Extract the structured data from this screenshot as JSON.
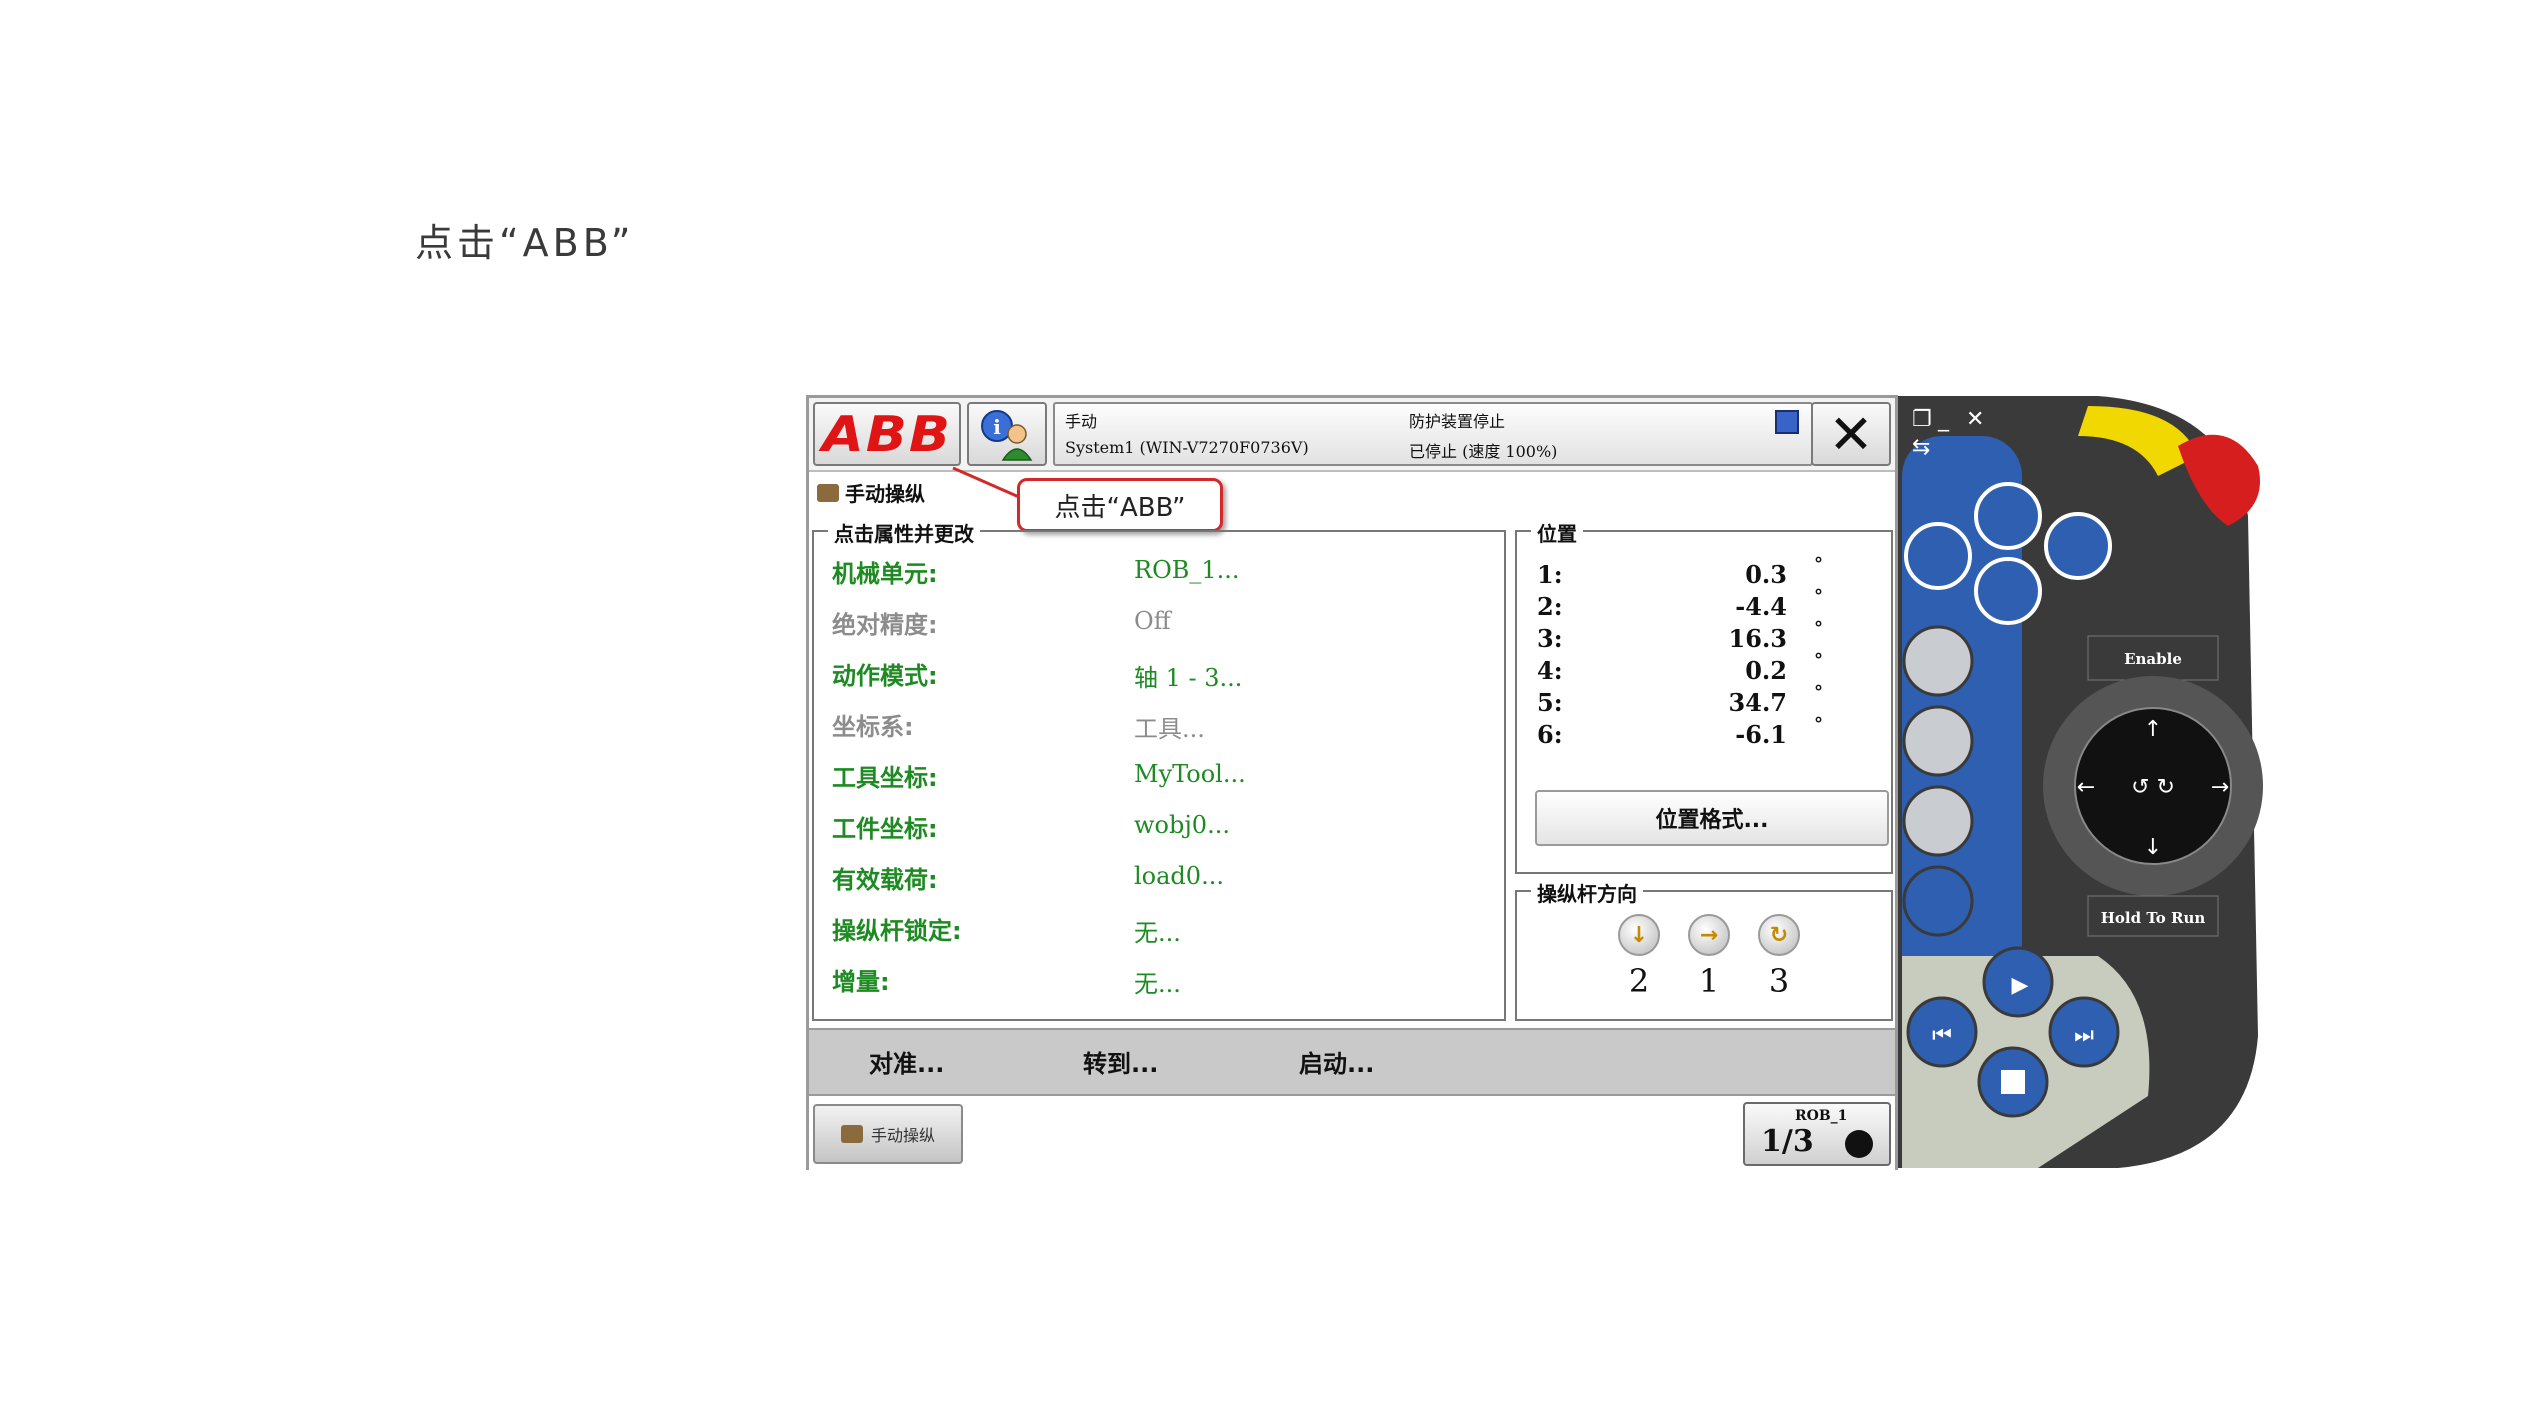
{
  "heading": "点击“ABB”",
  "topbar": {
    "abb_logo": "ABB",
    "mode": "手动",
    "system": "System1 (WIN-V7270F0736V)",
    "guard": "防护装置停止",
    "state": "已停止 (速度 100%)",
    "close_icon": "✕"
  },
  "jog": {
    "title": "手动操纵",
    "callout": "点击“ABB”"
  },
  "properties": {
    "legend": "点击属性并更改",
    "rows": [
      {
        "label": "机械单元:",
        "value": "ROB_1..."
      },
      {
        "label": "绝对精度:",
        "value": "Off"
      },
      {
        "label": "动作模式:",
        "value": "轴 1 - 3..."
      },
      {
        "label": "坐标系:",
        "value": "工具..."
      },
      {
        "label": "工具坐标:",
        "value": "MyTool..."
      },
      {
        "label": "工件坐标:",
        "value": "wobj0..."
      },
      {
        "label": "有效载荷:",
        "value": "load0..."
      },
      {
        "label": "操纵杆锁定:",
        "value": "无..."
      },
      {
        "label": "增量:",
        "value": "无..."
      }
    ]
  },
  "position": {
    "legend": "位置",
    "unit": "°",
    "axes": [
      {
        "name": "1:",
        "value": "0.3"
      },
      {
        "name": "2:",
        "value": "-4.4"
      },
      {
        "name": "3:",
        "value": "16.3"
      },
      {
        "name": "4:",
        "value": "0.2"
      },
      {
        "name": "5:",
        "value": "34.7"
      },
      {
        "name": "6:",
        "value": "-6.1"
      }
    ],
    "format_button": "位置格式..."
  },
  "joystick": {
    "legend": "操纵杆方向",
    "dirs": [
      "2",
      "1",
      "3"
    ]
  },
  "commands": {
    "align": "对准...",
    "goto": "转到...",
    "activate": "启动..."
  },
  "taskbar": {
    "jog_button": "手动操纵",
    "quickset_label": "ROB_1",
    "quickset_fraction": "1/3"
  },
  "pendant": {
    "enable_label": "Enable",
    "hold_label": "Hold To Run",
    "colors": {
      "body": "#3a3a3a",
      "panel": "#2f5fb0",
      "estop": "#d61e1e",
      "guard": "#f0d800"
    }
  }
}
